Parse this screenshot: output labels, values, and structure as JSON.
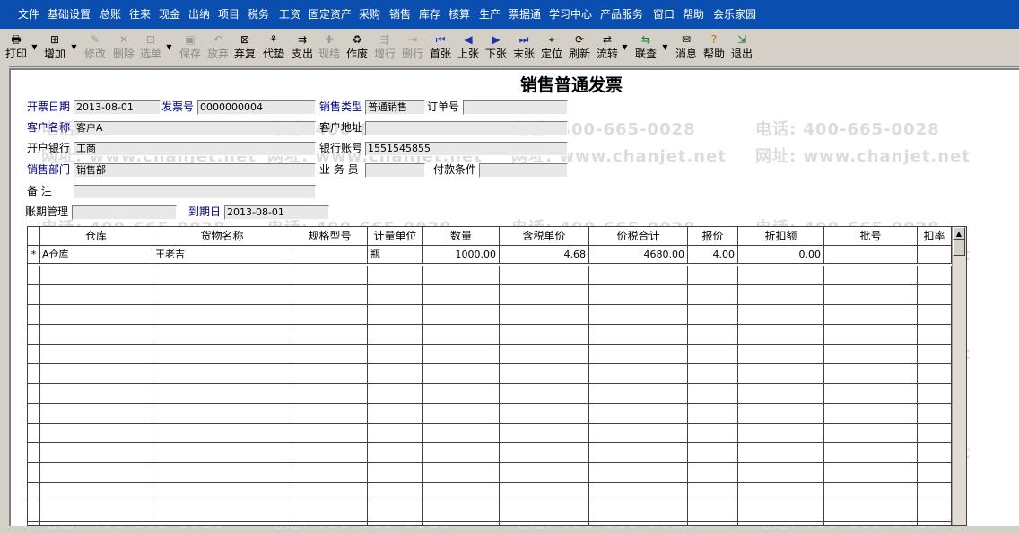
{
  "menu": [
    "文件",
    "基础设置",
    "总账",
    "往来",
    "现金",
    "出纳",
    "项目",
    "税务",
    "工资",
    "固定资产",
    "采购",
    "销售",
    "库存",
    "核算",
    "生产",
    "票据通",
    "学习中心",
    "产品服务",
    "窗口",
    "帮助",
    "会乐家园"
  ],
  "toolbar": {
    "print": "打印",
    "add": "增加",
    "edit": "修改",
    "delete": "删除",
    "select": "选单",
    "save": "保存",
    "discard": "放弃",
    "abandon": "弃复",
    "advance": "代垫",
    "expense": "支出",
    "settle": "现结",
    "void": "作废",
    "add_row": "增行",
    "del_row": "删行",
    "first": "首张",
    "prev": "上张",
    "next": "下张",
    "last": "末张",
    "locate": "定位",
    "refresh": "刷新",
    "flow": "流转",
    "link": "联查",
    "message": "消息",
    "help": "帮助",
    "exit": "退出"
  },
  "watermark": {
    "phone": "电话: 400-665-0028",
    "site": "网址: www.chanjet.net"
  },
  "form": {
    "title": "销售普通发票",
    "invoice_date_label": "开票日期",
    "invoice_date": "2013-08-01",
    "invoice_no_label": "发票号",
    "invoice_no": "0000000004",
    "sale_type_label": "销售类型",
    "sale_type": "普通销售",
    "order_no_label": "订单号",
    "order_no": "",
    "customer_label": "客户名称",
    "customer": "客户A",
    "customer_addr_label": "客户地址",
    "customer_addr": "",
    "bank_label": "开户银行",
    "bank": "工商",
    "account_label": "银行账号",
    "account": "1551545855",
    "dept_label": "销售部门",
    "dept": "销售部",
    "salesman_label": "业 务 员",
    "salesman": "",
    "terms_label": "付款条件",
    "terms": "",
    "remark_label": "备    注",
    "remark": "",
    "period_label": "账期管理",
    "period": "",
    "due_label": "到期日",
    "due": "2013-08-01"
  },
  "grid": {
    "columns": [
      "仓库",
      "货物名称",
      "规格型号",
      "计量单位",
      "数量",
      "含税单价",
      "价税合计",
      "报价",
      "折扣额",
      "批号",
      "扣率"
    ],
    "rows": [
      {
        "marker": "*",
        "warehouse": "A仓库",
        "goods": "王老吉",
        "spec": "",
        "unit": "瓶",
        "qty": "1000.00",
        "price": "4.68",
        "total": "4680.00",
        "quote": "4.00",
        "discount": "0.00",
        "batch": "",
        "rate": ""
      }
    ]
  }
}
